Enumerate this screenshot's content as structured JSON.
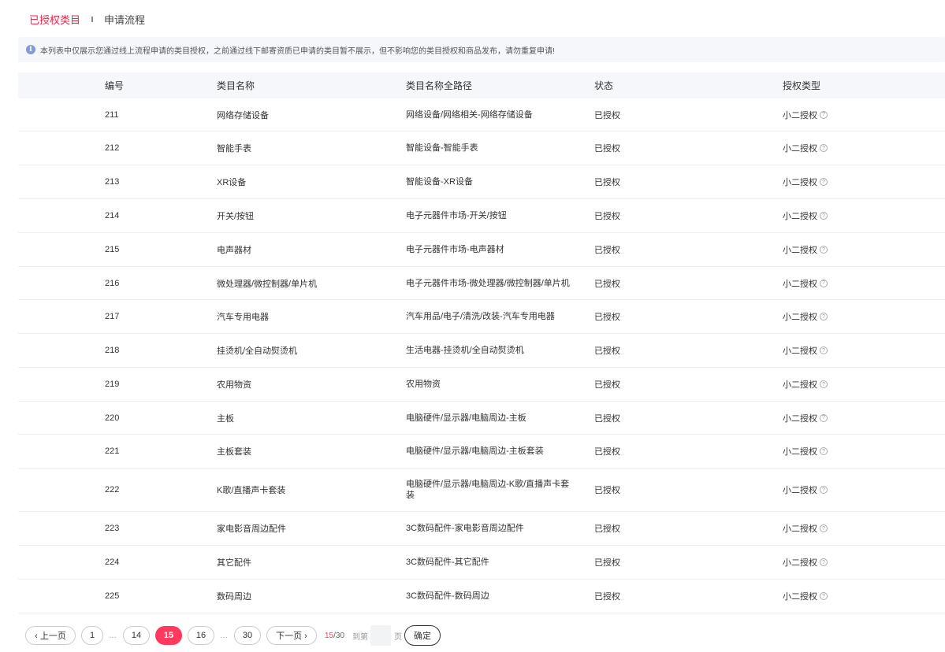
{
  "tabs": [
    {
      "label": "已授权类目",
      "active": true
    },
    {
      "label": "申请流程",
      "active": false
    }
  ],
  "notice": {
    "icon": "info-icon",
    "text": "本列表中仅展示您通过线上流程申请的类目授权，之前通过线下邮寄资质已申请的类目暂不展示，但不影响您的类目授权和商品发布，请勿重复申请!"
  },
  "table": {
    "columns": [
      "编号",
      "类目名称",
      "类目名称全路径",
      "状态",
      "授权类型"
    ],
    "rows": [
      {
        "id": "211",
        "name": "网络存储设备",
        "path": "网络设备/网络相关-网络存储设备",
        "status": "已授权",
        "auth": "小二授权"
      },
      {
        "id": "212",
        "name": "智能手表",
        "path": "智能设备-智能手表",
        "status": "已授权",
        "auth": "小二授权"
      },
      {
        "id": "213",
        "name": "XR设备",
        "path": "智能设备-XR设备",
        "status": "已授权",
        "auth": "小二授权"
      },
      {
        "id": "214",
        "name": "开关/按钮",
        "path": "电子元器件市场-开关/按钮",
        "status": "已授权",
        "auth": "小二授权"
      },
      {
        "id": "215",
        "name": "电声器材",
        "path": "电子元器件市场-电声器材",
        "status": "已授权",
        "auth": "小二授权"
      },
      {
        "id": "216",
        "name": "微处理器/微控制器/单片机",
        "path": "电子元器件市场-微处理器/微控制器/单片机",
        "status": "已授权",
        "auth": "小二授权"
      },
      {
        "id": "217",
        "name": "汽车专用电器",
        "path": "汽车用品/电子/清洗/改装-汽车专用电器",
        "status": "已授权",
        "auth": "小二授权"
      },
      {
        "id": "218",
        "name": "挂烫机/全自动熨烫机",
        "path": "生活电器-挂烫机/全自动熨烫机",
        "status": "已授权",
        "auth": "小二授权"
      },
      {
        "id": "219",
        "name": "农用物资",
        "path": "农用物资",
        "status": "已授权",
        "auth": "小二授权"
      },
      {
        "id": "220",
        "name": "主板",
        "path": "电脑硬件/显示器/电脑周边-主板",
        "status": "已授权",
        "auth": "小二授权"
      },
      {
        "id": "221",
        "name": "主板套装",
        "path": "电脑硬件/显示器/电脑周边-主板套装",
        "status": "已授权",
        "auth": "小二授权"
      },
      {
        "id": "222",
        "name": "K歌/直播声卡套装",
        "path": "电脑硬件/显示器/电脑周边-K歌/直播声卡套装",
        "status": "已授权",
        "auth": "小二授权"
      },
      {
        "id": "223",
        "name": "家电影音周边配件",
        "path": "3C数码配件-家电影音周边配件",
        "status": "已授权",
        "auth": "小二授权"
      },
      {
        "id": "224",
        "name": "其它配件",
        "path": "3C数码配件-其它配件",
        "status": "已授权",
        "auth": "小二授权"
      },
      {
        "id": "225",
        "name": "数码周边",
        "path": "3C数码配件-数码周边",
        "status": "已授权",
        "auth": "小二授权"
      }
    ]
  },
  "pagination": {
    "prev_label": "‹ 上一页",
    "next_label": "下一页 ›",
    "pages": [
      "1",
      "…",
      "14",
      "15",
      "16",
      "…",
      "30"
    ],
    "current": "15",
    "current_display": "15",
    "total_display": "/30",
    "goto_label": "到第",
    "page_label": "页",
    "confirm_label": "确定"
  }
}
